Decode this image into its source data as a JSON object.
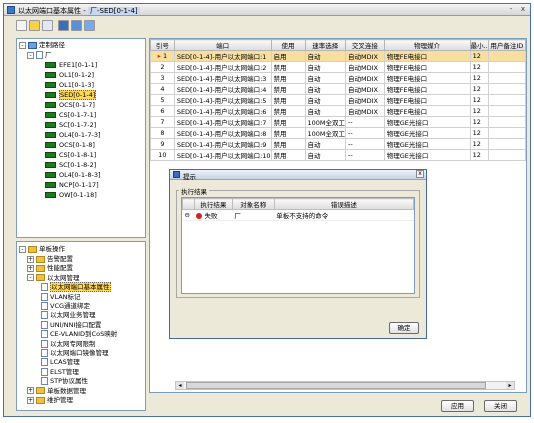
{
  "window": {
    "title": "以太网端口基本属性 - ",
    "title_suffix": "厂-SED[0-1-4]",
    "minimize": "-",
    "close": "x"
  },
  "toolbar": {
    "icons": [
      "new-icon",
      "open-icon",
      "save-icon",
      "monitor-icon",
      "filter-icon",
      "filter2-icon"
    ]
  },
  "tree_top": {
    "root_label": "定制路径",
    "ne_label": "厂",
    "boards": [
      "EFE1[0-1-1]",
      "OL1[0-1-2]",
      "OL1[0-1-3]",
      "SED[0-1-4]",
      "OCS[0-1-7]",
      "CS[0-1-7-1]",
      "SC[0-1-7-2]",
      "OL4[0-1-7-3]",
      "OCS[0-1-8]",
      "CS[0-1-8-1]",
      "SC[0-1-8-2]",
      "OL4[0-1-8-3]",
      "NCP[0-1-17]",
      "OW[0-1-18]"
    ],
    "selected_index": 3
  },
  "tree_bottom": {
    "root_label": "单板操作",
    "items": [
      {
        "label": "告警配置",
        "level": 1,
        "type": "folder"
      },
      {
        "label": "性能配置",
        "level": 1,
        "type": "folder"
      },
      {
        "label": "以太网管理",
        "level": 1,
        "type": "folder"
      },
      {
        "label": "以太网端口基本属性",
        "level": 2,
        "type": "doc",
        "selected": true
      },
      {
        "label": "VLAN标记",
        "level": 2,
        "type": "doc"
      },
      {
        "label": "VCG通道绑定",
        "level": 2,
        "type": "doc"
      },
      {
        "label": "以太网业务管理",
        "level": 2,
        "type": "doc"
      },
      {
        "label": "UNI/NNI接口配置",
        "level": 2,
        "type": "doc"
      },
      {
        "label": "CE-VLANID到CoS映射",
        "level": 2,
        "type": "doc"
      },
      {
        "label": "以太网专网限制",
        "level": 2,
        "type": "doc"
      },
      {
        "label": "以太网端口镜像管理",
        "level": 2,
        "type": "doc"
      },
      {
        "label": "LCAS管理",
        "level": 2,
        "type": "doc"
      },
      {
        "label": "ELST管理",
        "level": 2,
        "type": "doc"
      },
      {
        "label": "STP协议属性",
        "level": 2,
        "type": "doc"
      },
      {
        "label": "单板数据管理",
        "level": 1,
        "type": "folder"
      },
      {
        "label": "维护管理",
        "level": 1,
        "type": "folder"
      }
    ]
  },
  "table": {
    "headers": [
      "引号",
      "端口",
      "使用",
      "速率选择",
      "交叉连接",
      "物理媒介",
      "最小..",
      "用户备注ID"
    ],
    "rows": [
      [
        "1",
        "SED[0-1-4]-用户以太网端口:1",
        "启用",
        "自动",
        "自动MDIX",
        "物理FE电接口",
        "12",
        ""
      ],
      [
        "2",
        "SED[0-1-4]-用户以太网端口:2",
        "禁用",
        "自动",
        "自动MDIX",
        "物理FE电接口",
        "12",
        ""
      ],
      [
        "3",
        "SED[0-1-4]-用户以太网端口:3",
        "禁用",
        "自动",
        "自动MDIX",
        "物理FE电接口",
        "12",
        ""
      ],
      [
        "4",
        "SED[0-1-4]-用户以太网端口:4",
        "禁用",
        "自动",
        "自动MDIX",
        "物理FE电接口",
        "12",
        ""
      ],
      [
        "5",
        "SED[0-1-4]-用户以太网端口:5",
        "禁用",
        "自动",
        "自动MDIX",
        "物理FE电接口",
        "12",
        ""
      ],
      [
        "6",
        "SED[0-1-4]-用户以太网端口:6",
        "禁用",
        "自动",
        "自动MDIX",
        "物理FE电接口",
        "12",
        ""
      ],
      [
        "7",
        "SED[0-1-4]-用户以太网端口:7",
        "禁用",
        "100M全双工",
        "--",
        "物理GE光接口",
        "12",
        ""
      ],
      [
        "8",
        "SED[0-1-4]-用户以太网端口:8",
        "禁用",
        "100M全双工",
        "--",
        "物理GE光接口",
        "12",
        ""
      ],
      [
        "9",
        "SED[0-1-4]-用户以太网端口:9",
        "禁用",
        "自动",
        "--",
        "物理GE光接口",
        "12",
        ""
      ],
      [
        "10",
        "SED[0-1-4]-用户以太网端口:10",
        "禁用",
        "自动",
        "--",
        "物理GE光接口",
        "12",
        ""
      ]
    ],
    "selected_row": 0
  },
  "buttons": {
    "apply": "应用",
    "close": "关闭"
  },
  "dialog": {
    "title": "提示",
    "group_label": "执行结果",
    "headers": [
      "执行结果",
      "对象名称",
      "错误描述"
    ],
    "rows": [
      {
        "result": "失败",
        "object": "厂",
        "error": "单板不支持的命令"
      }
    ],
    "ok_label": "确定",
    "close_icon": "x"
  },
  "colors": {
    "selection": "#f8dfa0",
    "tree_selection": "#ffd75a",
    "board_icon": "#1f7a1f",
    "error": "#d92020"
  }
}
